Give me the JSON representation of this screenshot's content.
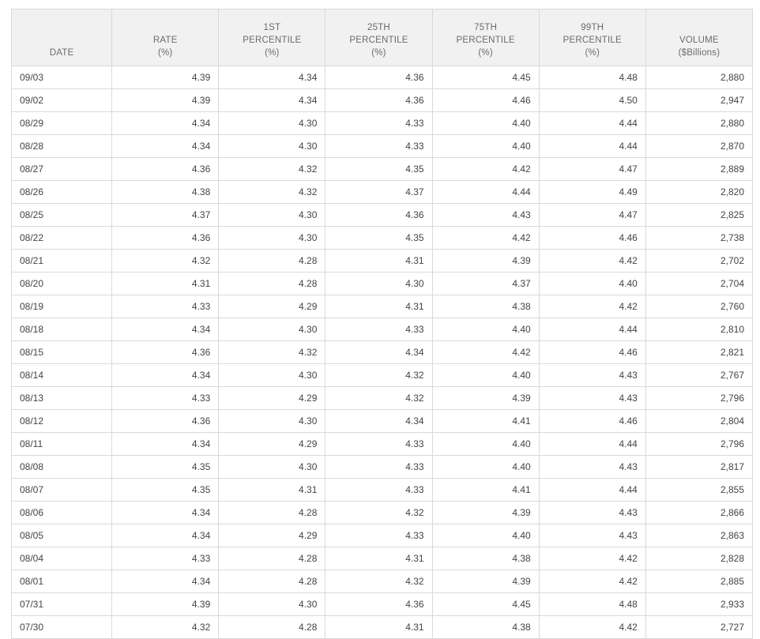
{
  "table": {
    "headers": [
      {
        "lines": [
          "DATE"
        ]
      },
      {
        "lines": [
          "RATE",
          "(%)"
        ]
      },
      {
        "lines": [
          "1ST",
          "PERCENTILE",
          "(%)"
        ]
      },
      {
        "lines": [
          "25TH",
          "PERCENTILE",
          "(%)"
        ]
      },
      {
        "lines": [
          "75TH",
          "PERCENTILE",
          "(%)"
        ]
      },
      {
        "lines": [
          "99TH",
          "PERCENTILE",
          "(%)"
        ]
      },
      {
        "lines": [
          "VOLUME",
          "($Billions)"
        ]
      }
    ],
    "rows": [
      [
        "09/03",
        "4.39",
        "4.34",
        "4.36",
        "4.45",
        "4.48",
        "2,880"
      ],
      [
        "09/02",
        "4.39",
        "4.34",
        "4.36",
        "4.46",
        "4.50",
        "2,947"
      ],
      [
        "08/29",
        "4.34",
        "4.30",
        "4.33",
        "4.40",
        "4.44",
        "2,880"
      ],
      [
        "08/28",
        "4.34",
        "4.30",
        "4.33",
        "4.40",
        "4.44",
        "2,870"
      ],
      [
        "08/27",
        "4.36",
        "4.32",
        "4.35",
        "4.42",
        "4.47",
        "2,889"
      ],
      [
        "08/26",
        "4.38",
        "4.32",
        "4.37",
        "4.44",
        "4.49",
        "2,820"
      ],
      [
        "08/25",
        "4.37",
        "4.30",
        "4.36",
        "4.43",
        "4.47",
        "2,825"
      ],
      [
        "08/22",
        "4.36",
        "4.30",
        "4.35",
        "4.42",
        "4.46",
        "2,738"
      ],
      [
        "08/21",
        "4.32",
        "4.28",
        "4.31",
        "4.39",
        "4.42",
        "2,702"
      ],
      [
        "08/20",
        "4.31",
        "4.28",
        "4.30",
        "4.37",
        "4.40",
        "2,704"
      ],
      [
        "08/19",
        "4.33",
        "4.29",
        "4.31",
        "4.38",
        "4.42",
        "2,760"
      ],
      [
        "08/18",
        "4.34",
        "4.30",
        "4.33",
        "4.40",
        "4.44",
        "2,810"
      ],
      [
        "08/15",
        "4.36",
        "4.32",
        "4.34",
        "4.42",
        "4.46",
        "2,821"
      ],
      [
        "08/14",
        "4.34",
        "4.30",
        "4.32",
        "4.40",
        "4.43",
        "2,767"
      ],
      [
        "08/13",
        "4.33",
        "4.29",
        "4.32",
        "4.39",
        "4.43",
        "2,796"
      ],
      [
        "08/12",
        "4.36",
        "4.30",
        "4.34",
        "4.41",
        "4.46",
        "2,804"
      ],
      [
        "08/11",
        "4.34",
        "4.29",
        "4.33",
        "4.40",
        "4.44",
        "2,796"
      ],
      [
        "08/08",
        "4.35",
        "4.30",
        "4.33",
        "4.40",
        "4.43",
        "2,817"
      ],
      [
        "08/07",
        "4.35",
        "4.31",
        "4.33",
        "4.41",
        "4.44",
        "2,855"
      ],
      [
        "08/06",
        "4.34",
        "4.28",
        "4.32",
        "4.39",
        "4.43",
        "2,866"
      ],
      [
        "08/05",
        "4.34",
        "4.29",
        "4.33",
        "4.40",
        "4.43",
        "2,863"
      ],
      [
        "08/04",
        "4.33",
        "4.28",
        "4.31",
        "4.38",
        "4.42",
        "2,828"
      ],
      [
        "08/01",
        "4.34",
        "4.28",
        "4.32",
        "4.39",
        "4.42",
        "2,885"
      ],
      [
        "07/31",
        "4.39",
        "4.30",
        "4.36",
        "4.45",
        "4.48",
        "2,933"
      ],
      [
        "07/30",
        "4.32",
        "4.28",
        "4.31",
        "4.38",
        "4.42",
        "2,727"
      ]
    ]
  },
  "colors": {
    "header_bg": "#f1f1f1",
    "border": "#d9d9d9",
    "text": "#444444"
  }
}
